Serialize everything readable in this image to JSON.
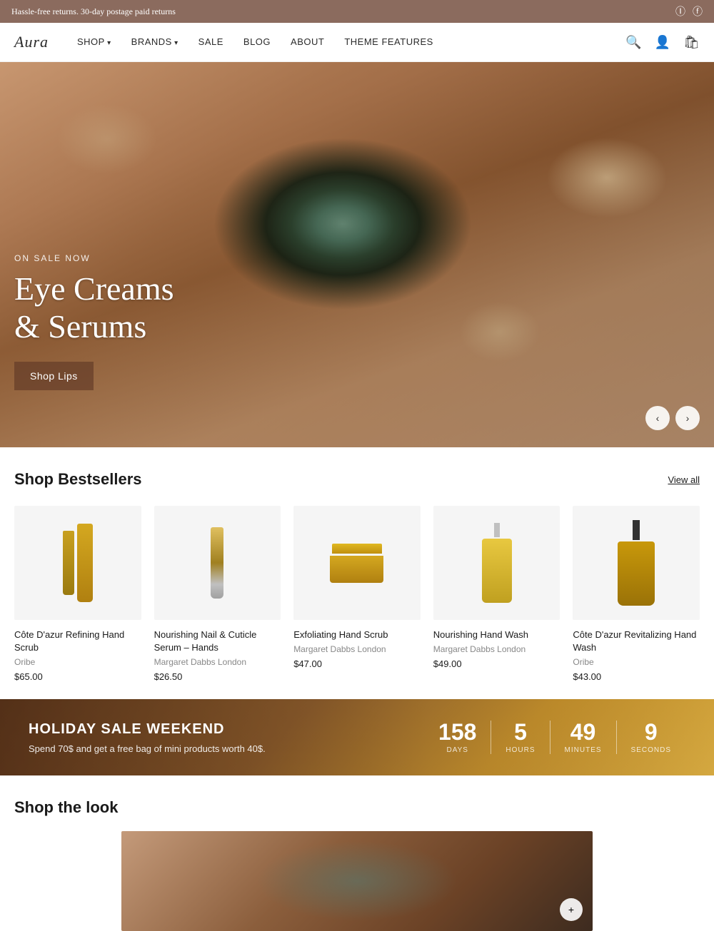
{
  "topbar": {
    "message": "Hassle-free returns. 30-day postage paid returns",
    "icons": [
      "instagram",
      "facebook"
    ]
  },
  "nav": {
    "logo": "Aura",
    "links": [
      {
        "label": "SHOP",
        "has_arrow": true
      },
      {
        "label": "BRANDS",
        "has_arrow": true
      },
      {
        "label": "SALE",
        "has_arrow": false
      },
      {
        "label": "BLOG",
        "has_arrow": false
      },
      {
        "label": "ABOUT",
        "has_arrow": false
      },
      {
        "label": "THEME FEATURES",
        "has_arrow": false
      }
    ]
  },
  "hero": {
    "sale_label": "ON SALE NOW",
    "title_line1": "Eye Creams",
    "title_line2": "& Serums",
    "cta_label": "Shop Lips"
  },
  "bestsellers": {
    "section_title": "Shop Bestsellers",
    "view_all_label": "View all",
    "products": [
      {
        "name": "Côte D'azur Refining Hand Scrub",
        "brand": "Oribe",
        "price": "$65.00",
        "img_type": "tube-set"
      },
      {
        "name": "Nourishing Nail & Cuticle Serum – Hands",
        "brand": "Margaret Dabbs London",
        "price": "$26.50",
        "img_type": "serum"
      },
      {
        "name": "Exfoliating Hand Scrub",
        "brand": "Margaret Dabbs London",
        "price": "$47.00",
        "img_type": "jar"
      },
      {
        "name": "Nourishing Hand Wash",
        "brand": "Margaret Dabbs London",
        "price": "$49.00",
        "img_type": "pump"
      },
      {
        "name": "Côte D'azur Revitalizing Hand Wash",
        "brand": "Oribe",
        "price": "$43.00",
        "img_type": "hand-pump"
      }
    ]
  },
  "sale_banner": {
    "title": "HOLIDAY SALE WEEKEND",
    "subtitle": "Spend 70$ and get a free bag of mini products worth 40$.",
    "countdown": {
      "days": "158",
      "days_label": "DAYS",
      "hours": "5",
      "hours_label": "HOURS",
      "minutes": "49",
      "minutes_label": "MINUTES",
      "seconds": "9",
      "seconds_label": "SECONDS"
    }
  },
  "shop_look": {
    "title": "Shop the look"
  }
}
